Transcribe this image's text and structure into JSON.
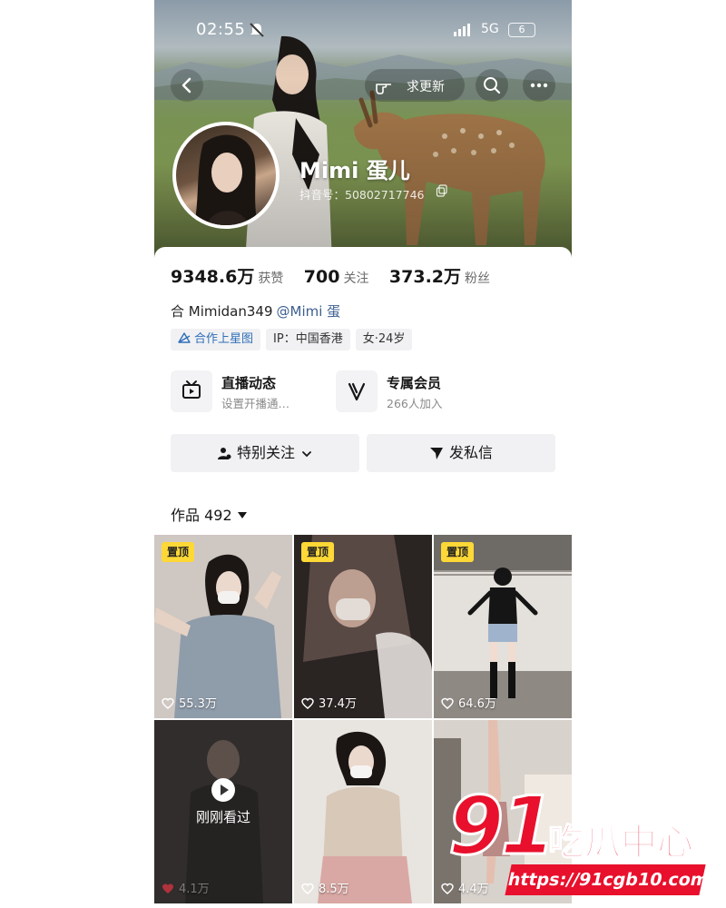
{
  "status_bar": {
    "time": "02:55",
    "network": "5G",
    "battery": "6"
  },
  "header": {
    "update_label": "求更新"
  },
  "profile": {
    "name": "Mimi 蛋儿",
    "douyin_id": "抖音号：50802717746",
    "stats": [
      {
        "value": "9348.6万",
        "label": "获赞"
      },
      {
        "value": "700",
        "label": "关注"
      },
      {
        "value": "373.2万",
        "label": "粉丝"
      }
    ],
    "collab": "合 Mimidan349",
    "mention": "@Mimi 蛋",
    "tags": [
      "合作上星图",
      "IP：中国香港",
      "女·24岁"
    ]
  },
  "features": [
    {
      "title": "直播动态",
      "subtitle": "设置开播通…",
      "icon": "tv-icon"
    },
    {
      "title": "专属会员",
      "subtitle": "266人加入",
      "icon": "v-badge-icon"
    }
  ],
  "actions": {
    "follow_label": "特别关注",
    "message_label": "发私信"
  },
  "works": {
    "label": "作品 492",
    "tiles": [
      {
        "pinned": "置顶",
        "likes": "55.3万"
      },
      {
        "pinned": "置顶",
        "likes": "37.4万"
      },
      {
        "pinned": "置顶",
        "likes": "64.6万"
      },
      {
        "seen": "刚刚看过",
        "likes": "4.1万"
      },
      {
        "likes": "8.5万"
      },
      {
        "likes": "4.4万"
      }
    ]
  },
  "watermark": {
    "number": "91",
    "text": "吃瓜中心",
    "url": "https://91cgb10.com"
  },
  "colors": {
    "accent_yellow": "#fdd836",
    "mention_blue": "#3d5f8f",
    "tag_blue": "#2f6fb8",
    "watermark_red": "#e8102c"
  }
}
